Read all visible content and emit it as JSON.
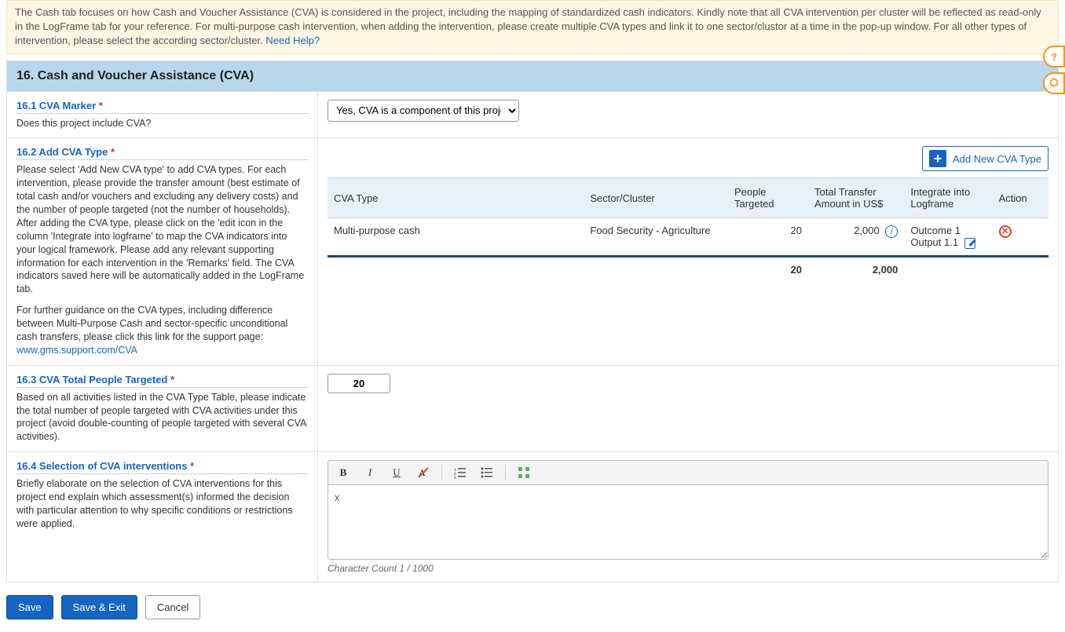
{
  "banner": {
    "text": "The Cash tab focuses on how Cash and Voucher Assistance (CVA) is considered in the project, including the mapping of standardized cash indicators. Kindly note that all CVA intervention per cluster will be reflected as read-only in the LogFrame tab for your reference. For multi-purpose cash intervention, when adding the intervention, please create multiple CVA types and link it to one sector/clustor at a time in the pop-up window. For all other types of intervention, please select the according sector/cluster.",
    "help_link": "Need Help?"
  },
  "section_title": "16. Cash and Voucher Assistance (CVA)",
  "s161": {
    "heading": "16.1 CVA Marker",
    "question": "Does this project include CVA?",
    "selected": "Yes, CVA is a component of this project"
  },
  "s162": {
    "heading": "16.2 Add CVA Type",
    "desc1": "Please select 'Add New CVA type' to add CVA types. For each intervention, please provide the transfer amount (best estimate of total cash and/or vouchers and excluding any delivery costs) and the number of people targeted (not the number of households). After adding the CVA type, please click on the 'edit icon in the column 'Integrate into logframe' to map the CVA indicators into your logical framework. Please add any relevant supporting information for each intervention in the 'Remarks' field. The CVA indicators saved here will be automatically added in the LogFrame tab.",
    "desc2": "For further guidance on the CVA types, including difference between Multi-Purpose Cash and sector-specific unconditional cash transfers, please click this link for the support page: ",
    "support_link": "www.gms.support.com/CVA",
    "add_button": "Add New CVA Type",
    "columns": {
      "type": "CVA Type",
      "sector": "Sector/Cluster",
      "people": "People Targeted",
      "amount": "Total Transfer Amount in US$",
      "logframe": "Integrate into Logframe",
      "action": "Action"
    },
    "rows": [
      {
        "type": "Multi-purpose cash",
        "sector": "Food Security - Agriculture",
        "people": "20",
        "amount": "2,000",
        "logframe": "Outcome 1 Output 1.1"
      }
    ],
    "totals": {
      "people": "20",
      "amount": "2,000"
    }
  },
  "s163": {
    "heading": "16.3 CVA Total People Targeted",
    "desc": "Based on all activities listed in the CVA Type Table, please indicate the total number of people targeted with CVA activities under this project (avoid double-counting of people targeted with several CVA activities).",
    "value": "20"
  },
  "s164": {
    "heading": "16.4 Selection of CVA interventions",
    "desc": "Briefly elaborate on the selection of CVA interventions for this project end explain which assessment(s) informed the decision with particular attention to why specific conditions or restrictions were applied.",
    "content": "x",
    "char_count": "Character Count 1 / 1000"
  },
  "buttons": {
    "save": "Save",
    "save_exit": "Save & Exit",
    "cancel": "Cancel"
  },
  "asterisk": "*"
}
